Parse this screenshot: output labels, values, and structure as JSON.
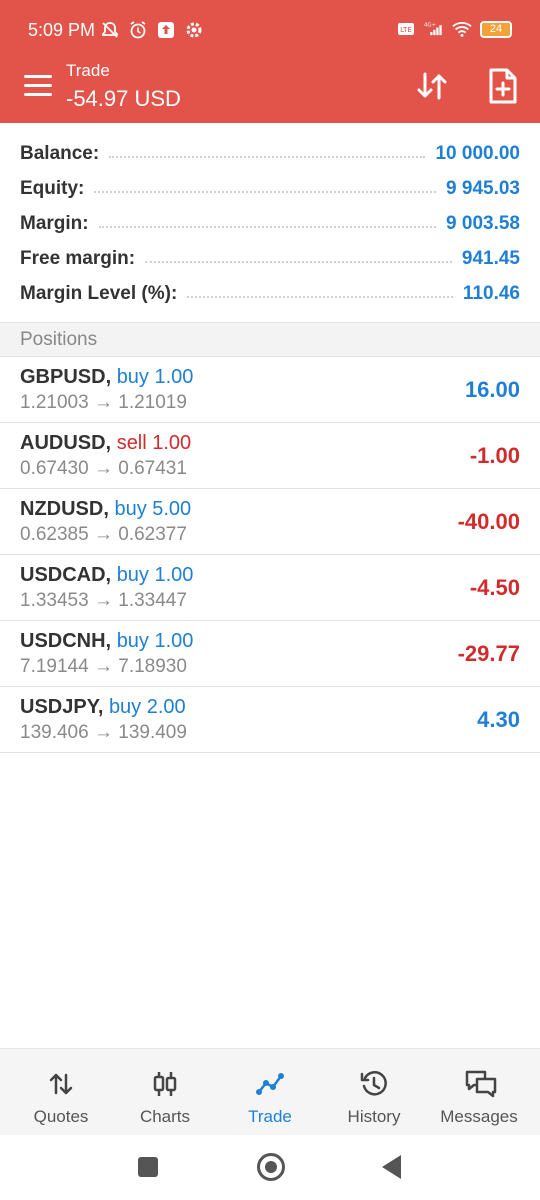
{
  "status_bar": {
    "time": "5:09 PM",
    "battery": "24",
    "left_icons": [
      "mute-icon",
      "alarm-icon",
      "upload-icon",
      "settings-icon"
    ],
    "right_icons": [
      "volte-icon",
      "signal-4g-icon",
      "wifi-icon",
      "battery-icon"
    ]
  },
  "header": {
    "title": "Trade",
    "subtitle": "-54.97 USD",
    "background": "#e2534a"
  },
  "summary": [
    {
      "label": "Balance:",
      "value": "10 000.00"
    },
    {
      "label": "Equity:",
      "value": "9 945.03"
    },
    {
      "label": "Margin:",
      "value": "9 003.58"
    },
    {
      "label": "Free margin:",
      "value": "941.45"
    },
    {
      "label": "Margin Level (%):",
      "value": "110.46"
    }
  ],
  "positions_header": "Positions",
  "positions": [
    {
      "symbol": "GBPUSD,",
      "side": "buy 1.00",
      "side_type": "buy",
      "open": "1.21003",
      "arrow": "→",
      "current": "1.21019",
      "profit": "16.00",
      "profit_sign": "pos"
    },
    {
      "symbol": "AUDUSD,",
      "side": "sell 1.00",
      "side_type": "sell",
      "open": "0.67430",
      "arrow": "→",
      "current": "0.67431",
      "profit": "-1.00",
      "profit_sign": "neg"
    },
    {
      "symbol": "NZDUSD,",
      "side": "buy 5.00",
      "side_type": "buy",
      "open": "0.62385",
      "arrow": "→",
      "current": "0.62377",
      "profit": "-40.00",
      "profit_sign": "neg"
    },
    {
      "symbol": "USDCAD,",
      "side": "buy 1.00",
      "side_type": "buy",
      "open": "1.33453",
      "arrow": "→",
      "current": "1.33447",
      "profit": "-4.50",
      "profit_sign": "neg"
    },
    {
      "symbol": "USDCNH,",
      "side": "buy 1.00",
      "side_type": "buy",
      "open": "7.19144",
      "arrow": "→",
      "current": "7.18930",
      "profit": "-29.77",
      "profit_sign": "neg"
    },
    {
      "symbol": "USDJPY,",
      "side": "buy 2.00",
      "side_type": "buy",
      "open": "139.406",
      "arrow": "→",
      "current": "139.409",
      "profit": "4.30",
      "profit_sign": "pos"
    }
  ],
  "bottom_nav": [
    {
      "label": "Quotes",
      "icon": "quotes-icon",
      "active": false
    },
    {
      "label": "Charts",
      "icon": "charts-icon",
      "active": false
    },
    {
      "label": "Trade",
      "icon": "trade-icon",
      "active": true
    },
    {
      "label": "History",
      "icon": "history-icon",
      "active": false
    },
    {
      "label": "Messages",
      "icon": "messages-icon",
      "active": false
    }
  ],
  "colors": {
    "accent_blue": "#1e7fd4",
    "loss_red": "#d22b2b",
    "header_red": "#e2534a"
  }
}
